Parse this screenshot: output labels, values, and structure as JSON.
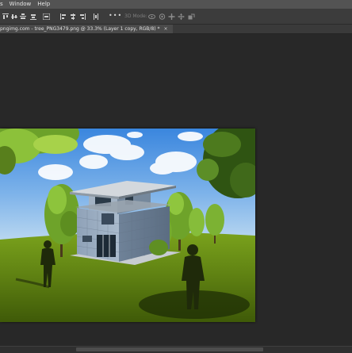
{
  "menubar": {
    "items": [
      {
        "label": "s"
      },
      {
        "label": "Window"
      },
      {
        "label": "Help"
      }
    ]
  },
  "optionsbar": {
    "icons": [
      "align-top-edges-icon",
      "align-vertical-centers-icon",
      "align-bottom-edges-icon",
      "align-middle-icon",
      "align-left-edges-icon",
      "align-horizontal-centers-icon",
      "align-right-edges-icon",
      "distribute-icon",
      "more-options-icon"
    ],
    "three_d_mode_label": "3D Mode:",
    "three_d_icons": [
      "orbit-3d-icon",
      "roll-3d-icon",
      "pan-3d-icon",
      "slide-3d-icon",
      "scale-3d-icon"
    ]
  },
  "document_tab": {
    "title": "pngimg.com - tree_PNG3479.png @ 33.3% (Layer 1 copy, RGB/8) *",
    "close_label": "×"
  },
  "canvas": {
    "image_description_icon": "composited-house-scene-image",
    "zoom": "33.3%"
  },
  "colors": {
    "menubar_bg": "#535353",
    "options_bg": "#3c3c3c",
    "workspace_bg": "#282828",
    "sky_top": "#3f8fe0",
    "grass": "#5a7d0f"
  }
}
